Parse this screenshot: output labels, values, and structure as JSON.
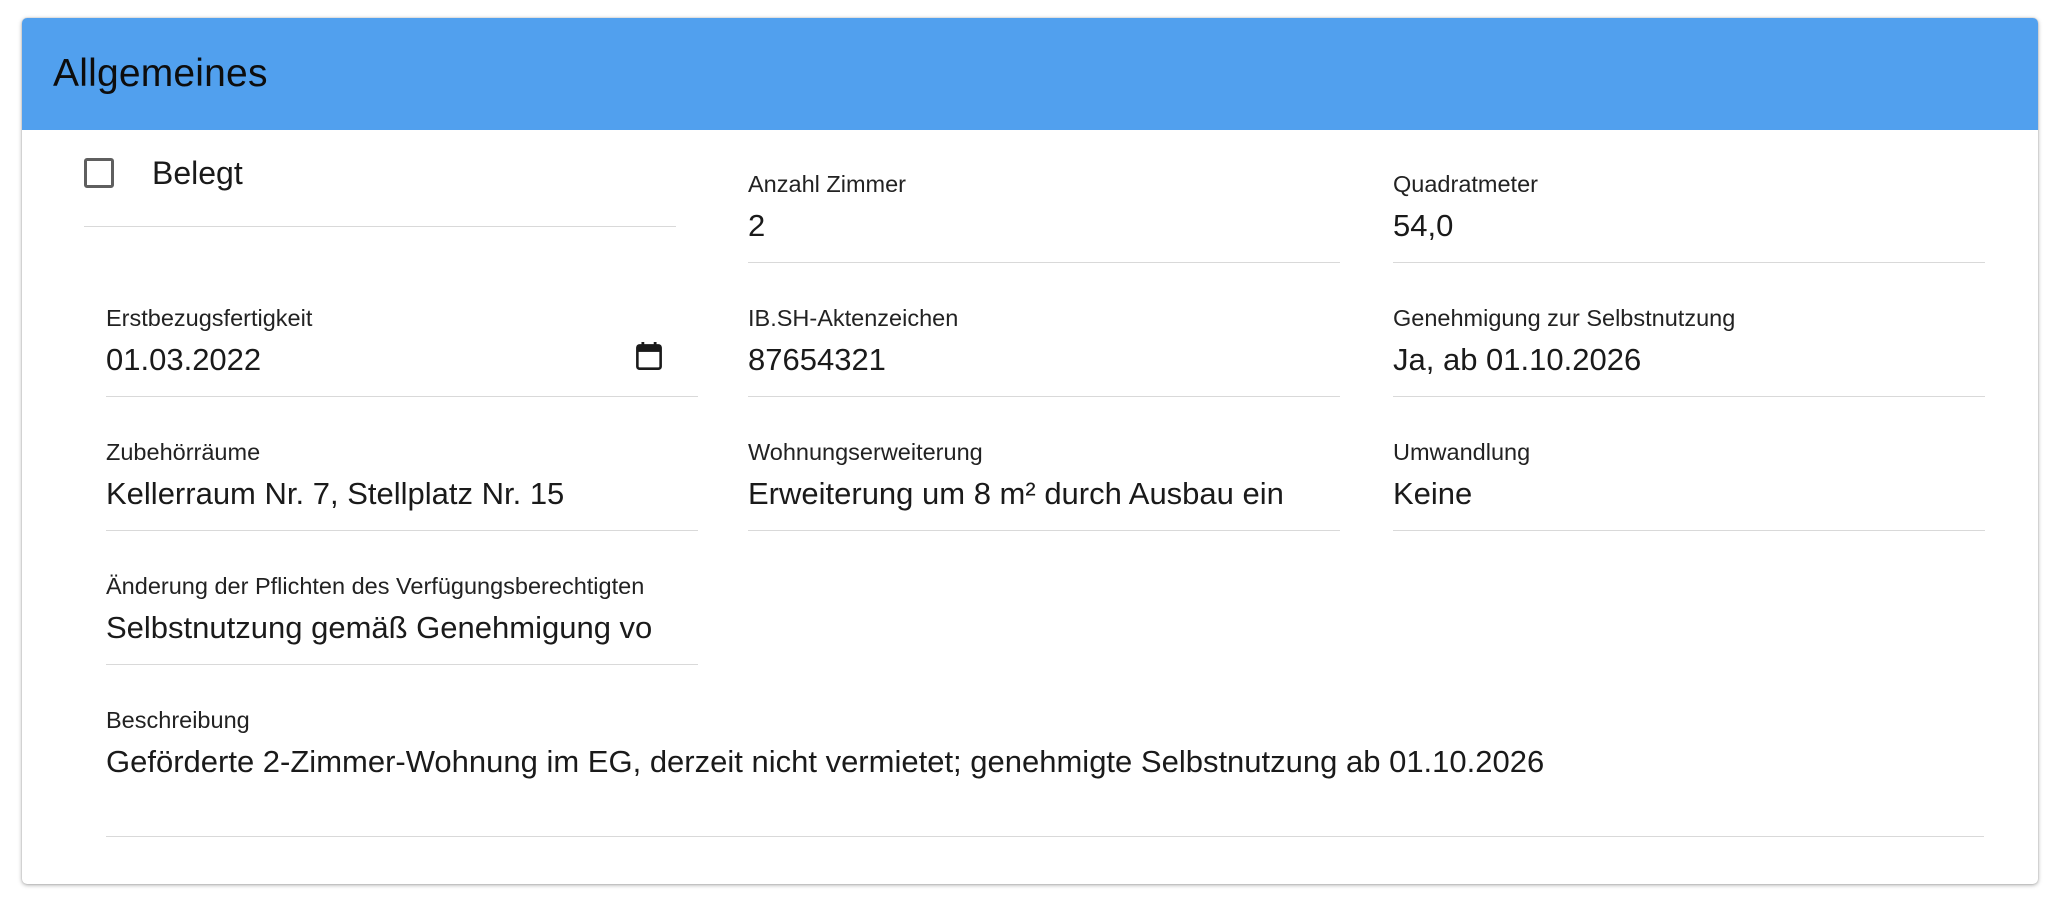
{
  "card": {
    "title": "Allgemeines"
  },
  "fields": {
    "belegt": {
      "label": "Belegt",
      "checked": false
    },
    "anzahl_zimmer": {
      "label": "Anzahl Zimmer",
      "value": "2"
    },
    "quadratmeter": {
      "label": "Quadratmeter",
      "value": "54,0"
    },
    "erstbezugsfertigkeit": {
      "label": "Erstbezugsfertigkeit",
      "value": "01.03.2022",
      "icon": "calendar-icon"
    },
    "aktenzeichen": {
      "label": "IB.SH-Aktenzeichen",
      "value": "87654321"
    },
    "genehmigung": {
      "label": "Genehmigung zur Selbstnutzung",
      "value": "Ja, ab 01.10.2026"
    },
    "zubehoerraeume": {
      "label": "Zubehörräume",
      "value": "Kellerraum Nr. 7, Stellplatz Nr. 15"
    },
    "wohnungserweiterung": {
      "label": "Wohnungserweiterung",
      "value": "Erweiterung um 8 m² durch Ausbau ein"
    },
    "umwandlung": {
      "label": "Umwandlung",
      "value": "Keine"
    },
    "aenderung_pflichten": {
      "label": "Änderung der Pflichten des Verfügungsberechtigten",
      "value": "Selbstnutzung gemäß Genehmigung vo"
    },
    "beschreibung": {
      "label": "Beschreibung",
      "value": "Geförderte 2-Zimmer-Wohnung im EG, derzeit nicht vermietet; genehmigte Selbstnutzung ab 01.10.2026"
    }
  },
  "colors": {
    "header_background": "#51a0ee",
    "field_underline": "#d9d9d9"
  }
}
